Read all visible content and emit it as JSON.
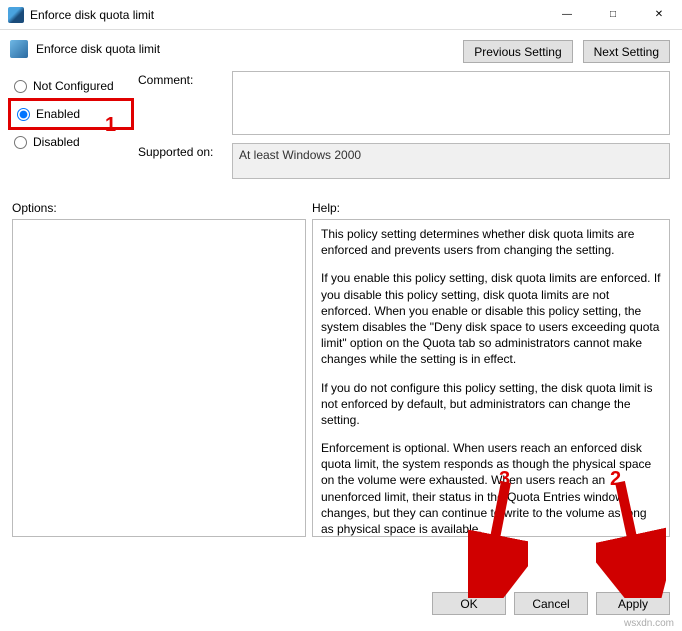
{
  "window": {
    "title": "Enforce disk quota limit"
  },
  "header": {
    "policy_title": "Enforce disk quota limit",
    "prev_btn": "Previous Setting",
    "next_btn": "Next Setting"
  },
  "state": {
    "not_configured": "Not Configured",
    "enabled": "Enabled",
    "disabled": "Disabled",
    "selected": "Enabled"
  },
  "labels": {
    "comment": "Comment:",
    "supported_on": "Supported on:",
    "options": "Options:",
    "help": "Help:"
  },
  "fields": {
    "comment_value": "",
    "supported_value": "At least Windows 2000"
  },
  "help_text": {
    "p1": "This policy setting determines whether disk quota limits are enforced and prevents users from changing the setting.",
    "p2": "If you enable this policy setting, disk quota limits are enforced. If you disable this policy setting, disk quota limits are not enforced. When you enable or disable this policy setting, the system disables the \"Deny disk space to users exceeding quota limit\" option on the Quota tab so administrators cannot make changes while the setting is in effect.",
    "p3": "If you do not configure this policy setting, the disk quota limit is not enforced by default, but administrators can change the setting.",
    "p4": "Enforcement is optional. When users reach an enforced disk quota limit, the system responds as though the physical space on the volume were exhausted. When users reach an unenforced limit, their status in the Quota Entries window changes, but they can continue to write to the volume as long as physical space is available."
  },
  "footer": {
    "ok": "OK",
    "cancel": "Cancel",
    "apply": "Apply"
  },
  "annotations": {
    "n1": "1",
    "n2": "2",
    "n3": "3"
  },
  "watermark": "wsxdn.com"
}
